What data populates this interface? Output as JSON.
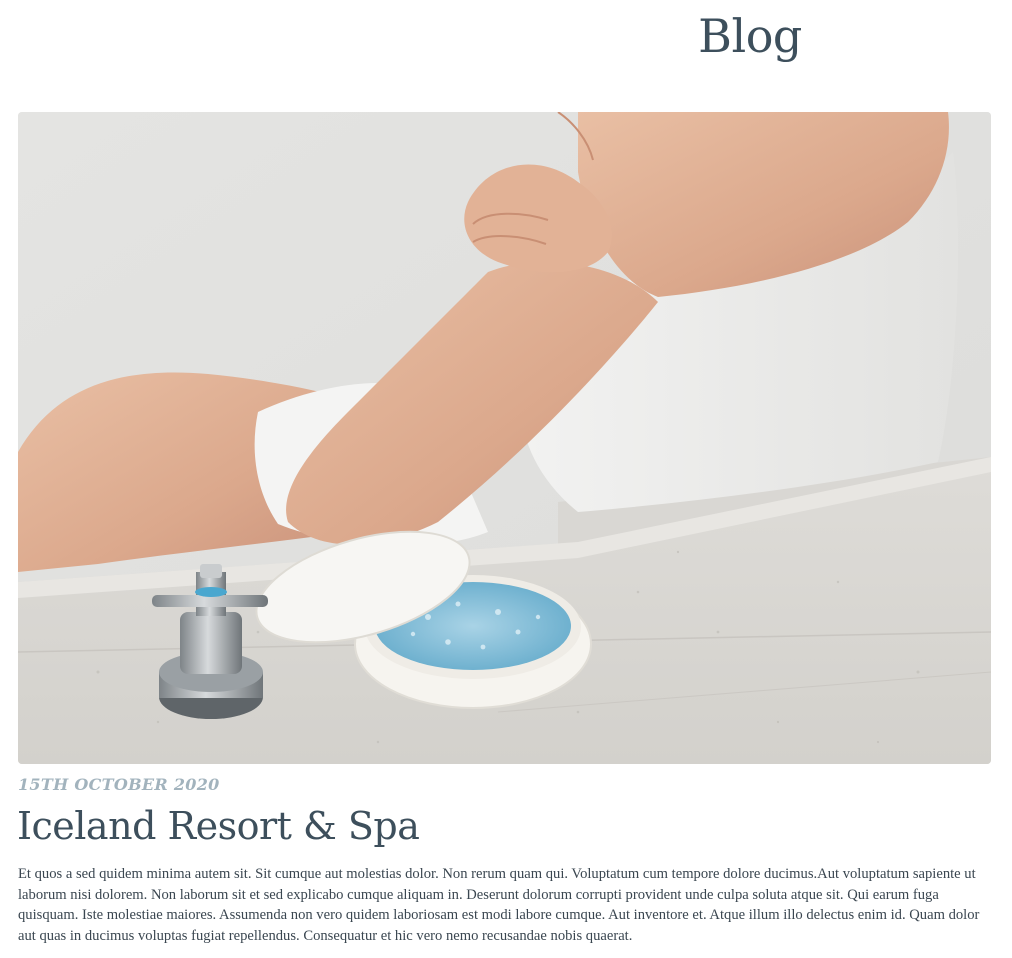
{
  "header": {
    "title": "Blog"
  },
  "post": {
    "image_icon": "spa-bath-photo",
    "date": "15TH OCTOBER 2020",
    "title": "Iceland Resort & Spa",
    "excerpt": "Et quos a sed quidem minima autem sit. Sit cumque aut molestias dolor. Non rerum quam qui. Voluptatum cum tempore dolore ducimus.Aut voluptatum sapiente ut laborum nisi dolorem. Non laborum sit et sed explicabo cumque aliquam in. Deserunt dolorum corrupti provident unde culpa soluta atque sit. Qui earum fuga quisquam. Iste molestiae maiores. Assumenda non vero quidem laboriosam est modi labore cumque. Aut inventore et. Atque illum illo delectus enim id. Quam dolor aut quas in ducimus voluptas fugiat repellendus. Consequatur et hic vero nemo recusandae nobis quaerat."
  },
  "colors": {
    "heading": "#3d4f5c",
    "date": "#a2b3bd",
    "body_text": "#3a4650",
    "background": "#ffffff"
  }
}
